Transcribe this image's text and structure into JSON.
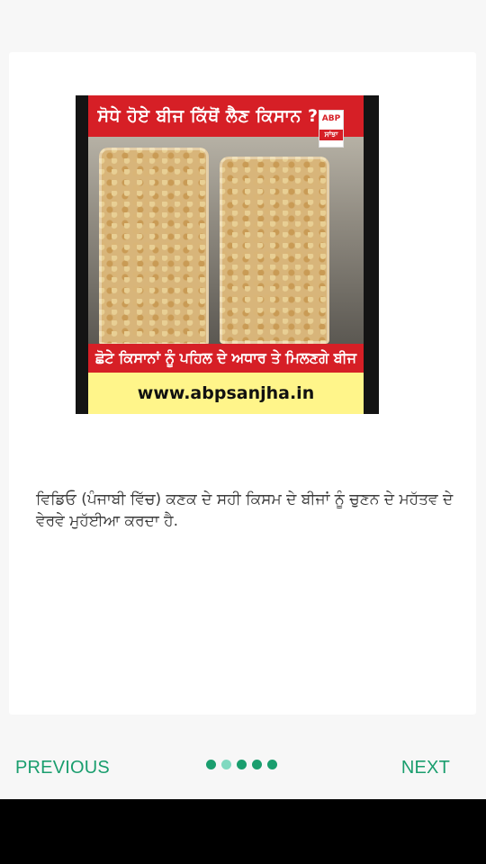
{
  "video": {
    "banner_top": "ਸੋਧੇ ਹੋਏ ਬੀਜ ਕਿੱਥੋਂ ਲੈਣ ਕਿਸਾਨ ?",
    "logo_text": "ABP",
    "logo_sub": "ਸਾਂਝਾ",
    "banner_bottom": "ਛੋਟੇ ਕਿਸਾਨਾਂ ਨੂੰ ਪਹਿਲ ਦੇ ਅਧਾਰ ਤੇ ਮਿਲਣਗੇ ਬੀਜ",
    "url": "www.abpsanjha.in"
  },
  "description": "ਵਿਡਿਓ (ਪੰਜਾਬੀ ਵਿੱਚ) ਕਣਕ ਦੇ ਸਹੀ ਕਿਸਮ ਦੇ ਬੀਜਾਂ ਨੂੰ ਚੁਣਨ ਦੇ ਮਹੱਤਵ ਦੇ ਵੇਰਵੇ ਮੁਹੱਈਆ ਕਰਦਾ ਹੈ.",
  "nav": {
    "previous": "PREVIOUS",
    "next": "NEXT",
    "pages": 5,
    "active_page": 2
  },
  "colors": {
    "accent": "#1a9e6e",
    "dot_inactive": "#7fd9c0",
    "banner_red": "#d61f26",
    "banner_yellow": "#fff58a"
  }
}
